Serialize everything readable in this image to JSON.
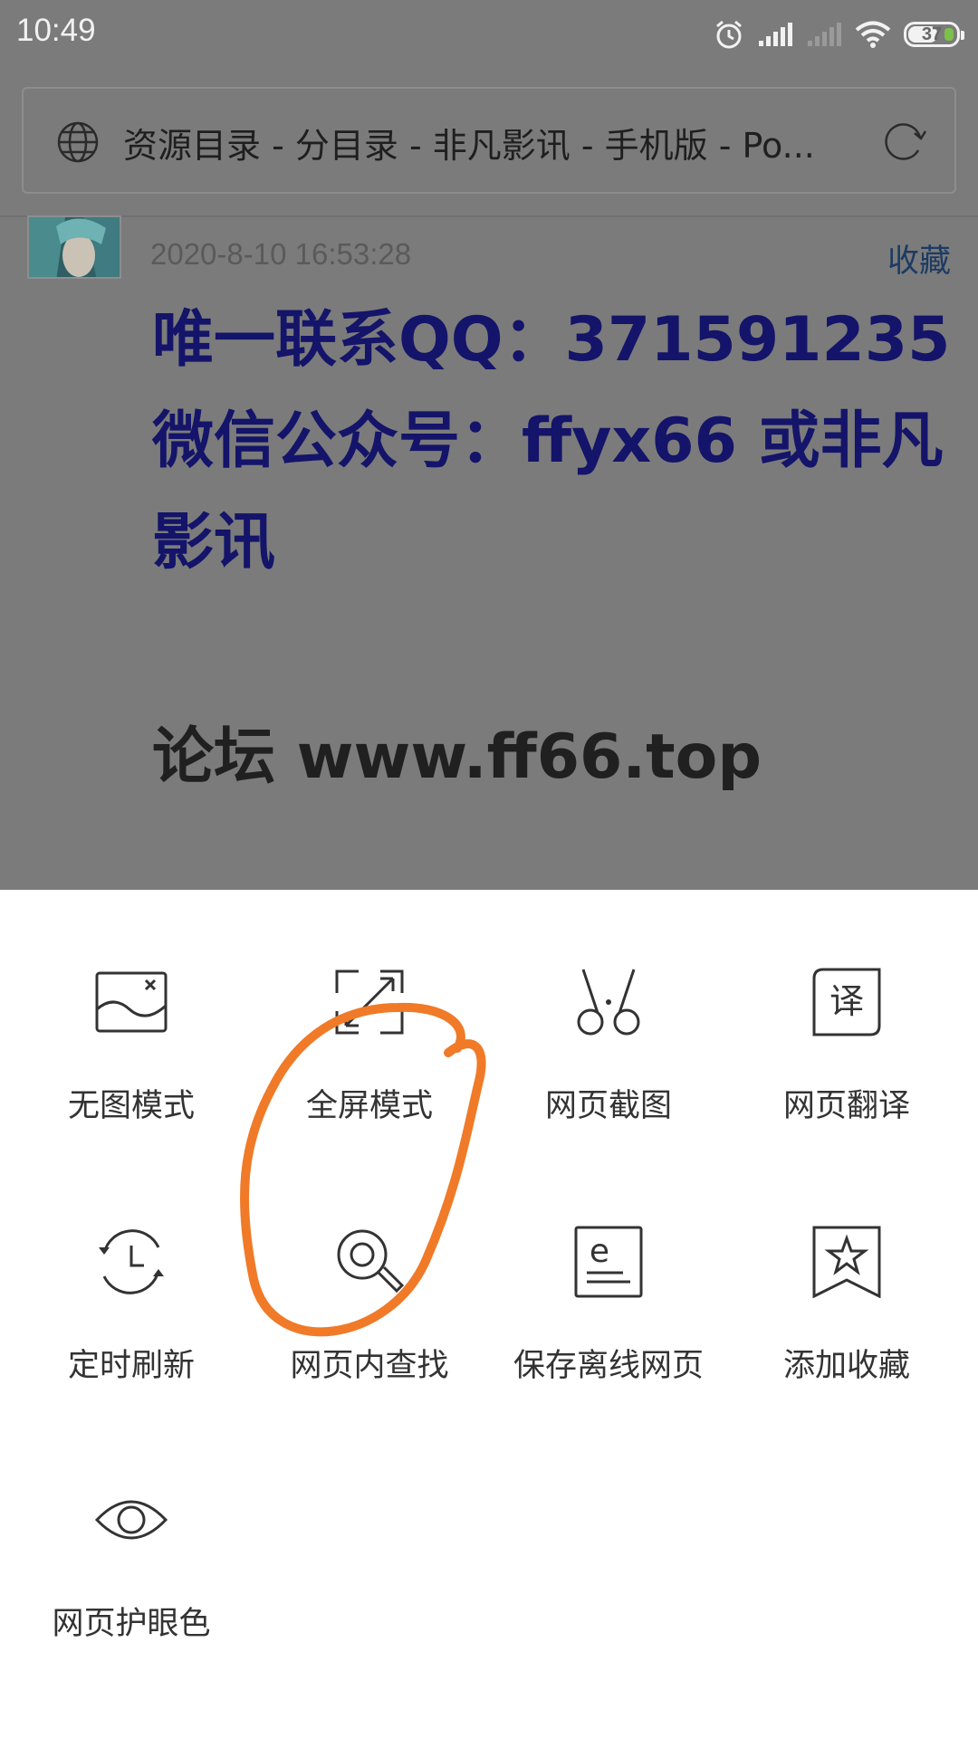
{
  "status_bar": {
    "time": "10:49",
    "battery_level": "37",
    "icons": [
      "alarm-icon",
      "signal-icon",
      "signal-weak-icon",
      "wifi-icon",
      "battery-icon"
    ]
  },
  "address_bar": {
    "title": "资源目录 - 分目录 - 非凡影讯 - 手机版 - Po..."
  },
  "post": {
    "date": "2020-8-10 16:53:28",
    "favorite_label": "收藏",
    "lines": [
      "唯一联系QQ：371591235",
      "微信公众号：ffyx66 或非凡",
      "影讯"
    ],
    "forum": "论坛 www.ff66.top"
  },
  "menu": {
    "items": [
      {
        "label": "无图模式",
        "icon": "no-image-icon"
      },
      {
        "label": "全屏模式",
        "icon": "fullscreen-icon"
      },
      {
        "label": "网页截图",
        "icon": "scissors-icon"
      },
      {
        "label": "网页翻译",
        "icon": "translate-icon"
      },
      {
        "label": "定时刷新",
        "icon": "timer-refresh-icon"
      },
      {
        "label": "网页内查找",
        "icon": "search-icon"
      },
      {
        "label": "保存离线网页",
        "icon": "offline-page-icon"
      },
      {
        "label": "添加收藏",
        "icon": "bookmark-star-icon"
      },
      {
        "label": "网页护眼色",
        "icon": "eye-icon"
      }
    ]
  },
  "colors": {
    "overlay": "#7b7b7b",
    "post_text": "#14146a",
    "annotation": "#f07a28"
  }
}
